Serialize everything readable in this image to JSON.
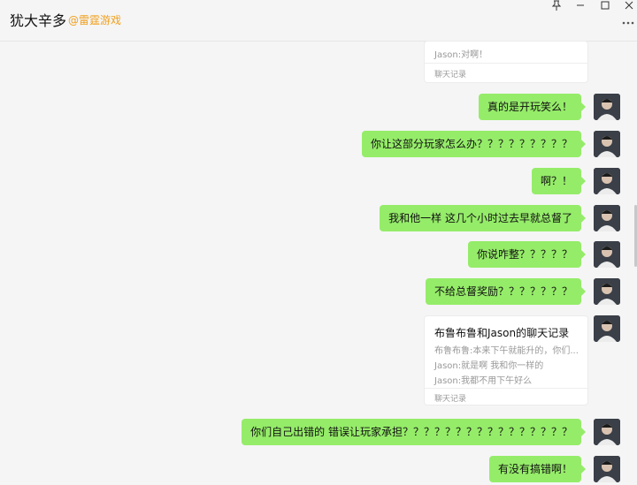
{
  "header": {
    "title": "犹大辛多",
    "subtitle": "@雷霆游戏",
    "pin_icon": "pin-icon",
    "minimize_icon": "minimize-icon",
    "maximize_icon": "maximize-icon",
    "close_icon": "close-icon",
    "more_icon": "more-icon"
  },
  "top_card": {
    "last_line": "Jason:对啊！",
    "footer": "聊天记录"
  },
  "messages": [
    "真的是开玩笑么！",
    "你让这部分玩家怎么办？？？？？？？？？",
    "啊？！",
    "我和他一样  这几个小时过去早就总督了",
    "你说咋整？？？？？",
    "不给总督奖励？？？？？？？",
    "你们自己出错的  错误让玩家承担？？？？？？？？？？？？？？？？",
    "有没有搞错啊！"
  ],
  "chat_card": {
    "title": "布鲁布鲁和Jason的聊天记录",
    "lines": [
      "布鲁布鲁:本来下午就能升的，你们...",
      "Jason:就是啊  我和你一样的",
      "Jason:我都不用下午好么"
    ],
    "footer": "聊天记录"
  },
  "colors": {
    "bubble": "#95ec69",
    "background": "#f5f5f5",
    "accent": "#f0a020"
  }
}
